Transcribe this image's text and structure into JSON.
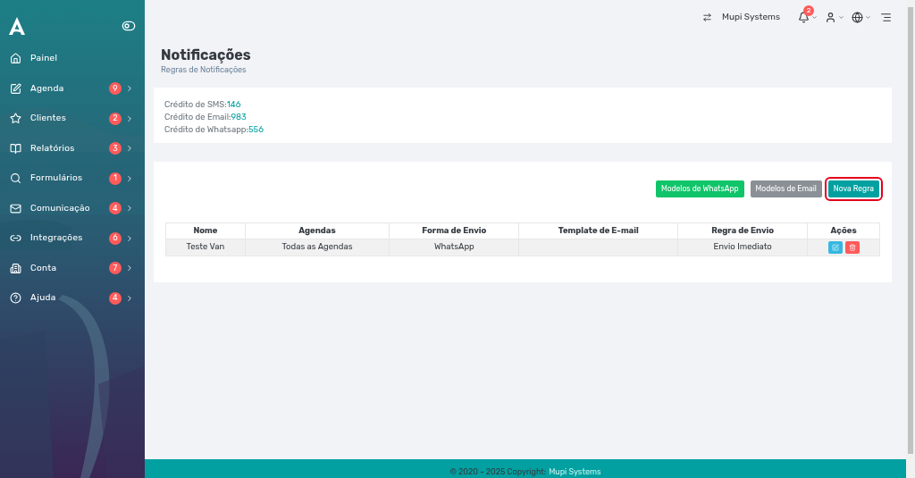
{
  "sidebar": {
    "items": [
      {
        "label": "Painel"
      },
      {
        "label": "Agenda",
        "badge": "9"
      },
      {
        "label": "Clientes",
        "badge": "2"
      },
      {
        "label": "Relatórios",
        "badge": "3"
      },
      {
        "label": "Formulários",
        "badge": "1"
      },
      {
        "label": "Comunicação",
        "badge": "4"
      },
      {
        "label": "Integrações",
        "badge": "6"
      },
      {
        "label": "Conta",
        "badge": "7"
      },
      {
        "label": "Ajuda",
        "badge": "4"
      }
    ]
  },
  "topbar": {
    "company": "Mupi Systems",
    "notification_count": "2"
  },
  "page": {
    "title": "Notificações",
    "subtitle": "Regras de Notificações"
  },
  "credits": [
    {
      "label": "Crédito de SMS:",
      "value": "146"
    },
    {
      "label": "Crédito de Email:",
      "value": "983"
    },
    {
      "label": "Crédito de Whatsapp:",
      "value": "556"
    }
  ],
  "buttons": [
    {
      "label": "Modelos de WhatsApp",
      "kind": "success",
      "highlighted": false
    },
    {
      "label": "Modelos de Email",
      "kind": "secondary",
      "highlighted": false
    },
    {
      "label": "Nova Regra",
      "kind": "primary",
      "highlighted": true
    }
  ],
  "table": {
    "columns": [
      "Nome",
      "Agendas",
      "Forma de Envio",
      "Template de E-mail",
      "Regra de Envio",
      "Ações"
    ],
    "rows": [
      {
        "cells": [
          "Teste Van",
          "Todas as Agendas",
          "WhatsApp",
          "",
          "Envio Imediato"
        ]
      }
    ]
  },
  "footer": {
    "text": "© 2020 - 2025 Copyright:",
    "link": "Mupi Systems"
  }
}
